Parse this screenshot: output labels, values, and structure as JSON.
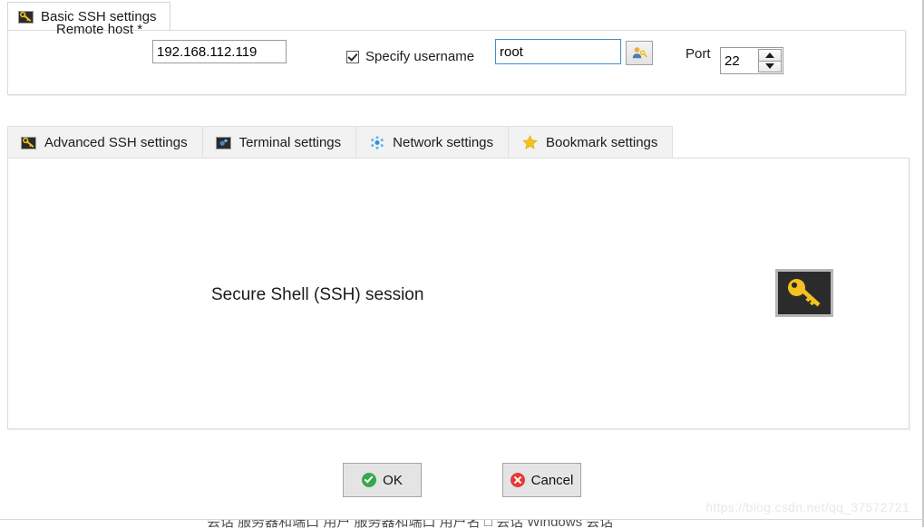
{
  "window": {
    "watermark": "https://blog.csdn.net/qq_37572721",
    "bottom_clipped_text": "会话   服务器和端口   用户  服务器和端口   用户名   □ 会话  Windows 会话"
  },
  "primary_tabs": [
    {
      "label": "Basic SSH settings",
      "icon": "key-tile-icon",
      "active": true
    }
  ],
  "basic_settings": {
    "remote_host": {
      "label": "Remote host *",
      "value": "192.168.112.119",
      "placeholder": ""
    },
    "specify_username": {
      "label": "Specify username",
      "checked": true
    },
    "username": {
      "value": "root",
      "placeholder": ""
    },
    "user_key_button": {
      "icon": "user-key-icon",
      "tooltip": ""
    },
    "port": {
      "label": "Port",
      "value": "22",
      "placeholder": ""
    }
  },
  "secondary_tabs": [
    {
      "label": "Advanced SSH settings",
      "icon": "key-tile-icon",
      "active": false
    },
    {
      "label": "Terminal settings",
      "icon": "terminal-dots-icon",
      "active": false
    },
    {
      "label": "Network settings",
      "icon": "network-nodes-icon",
      "active": false
    },
    {
      "label": "Bookmark settings",
      "icon": "star-icon",
      "active": false
    }
  ],
  "content_panel": {
    "session_type": "Secure Shell (SSH) session",
    "session_icon": "key-icon"
  },
  "footer": {
    "ok_label": "OK",
    "cancel_label": "Cancel"
  },
  "colors": {
    "accent_focus": "#3f8fd0",
    "key_gold": "#f5c11e",
    "ok_green": "#36a94b",
    "cancel_red": "#e33a36",
    "tile_dark": "#2b2b2b",
    "tab_inactive": "#f2f2f2"
  }
}
